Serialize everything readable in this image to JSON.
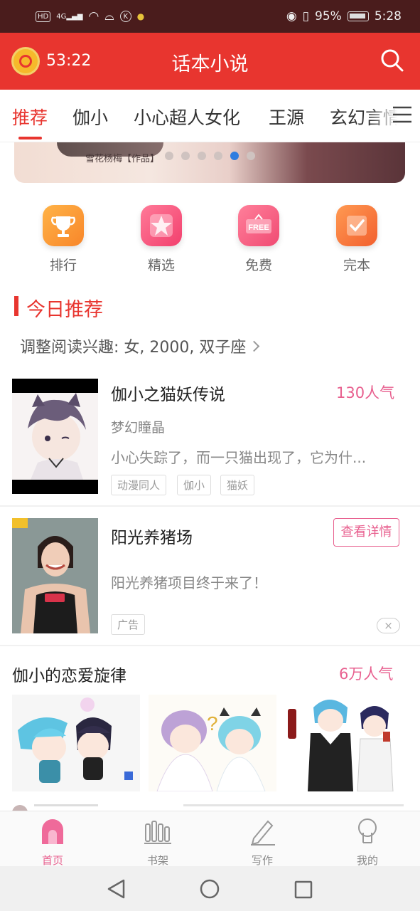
{
  "status_bar": {
    "hd": "HD",
    "network": "4G",
    "battery": "95%",
    "time": "5:28"
  },
  "header": {
    "timer": "53:22",
    "title": "话本小说",
    "accent": "#e8352f"
  },
  "tabs": [
    {
      "label": "推荐",
      "active": true
    },
    {
      "label": "伽小"
    },
    {
      "label": "小心超人女化"
    },
    {
      "label": "王源"
    },
    {
      "label": "玄幻言情"
    }
  ],
  "banner": {
    "caption": "雪花杨梅【作品】",
    "dot_count": 6,
    "active_dot": 4
  },
  "quick_entries": [
    {
      "label": "排行",
      "icon": "trophy-icon",
      "color": "#f89a2c"
    },
    {
      "label": "精选",
      "icon": "star-icon",
      "color": "#f6517a"
    },
    {
      "label": "免费",
      "icon": "free-icon",
      "color": "#f5587b",
      "badge": "FREE"
    },
    {
      "label": "完本",
      "icon": "check-icon",
      "color": "#f7693a"
    }
  ],
  "section": {
    "title": "今日推荐",
    "interest": "调整阅读兴趣: 女, 2000, 双子座"
  },
  "book1": {
    "title": "伽小之猫妖传说",
    "popularity": "130人气",
    "author": "梦幻瞳晶",
    "description": "小心失踪了，而一只猫出现了，它为什...",
    "tags": [
      "动漫同人",
      "伽小",
      "猫妖"
    ]
  },
  "ad": {
    "title": "阳光养猪场",
    "button": "查看详情",
    "description": "阳光养猪项目终于来了！",
    "tag": "广告",
    "close": "×"
  },
  "book2": {
    "title": "伽小的恋爱旋律",
    "popularity": "6万人气"
  },
  "bottom_nav": [
    {
      "label": "首页",
      "icon": "home-icon",
      "active": true
    },
    {
      "label": "书架",
      "icon": "bookshelf-icon"
    },
    {
      "label": "写作",
      "icon": "pen-icon"
    },
    {
      "label": "我的",
      "icon": "profile-icon"
    }
  ]
}
